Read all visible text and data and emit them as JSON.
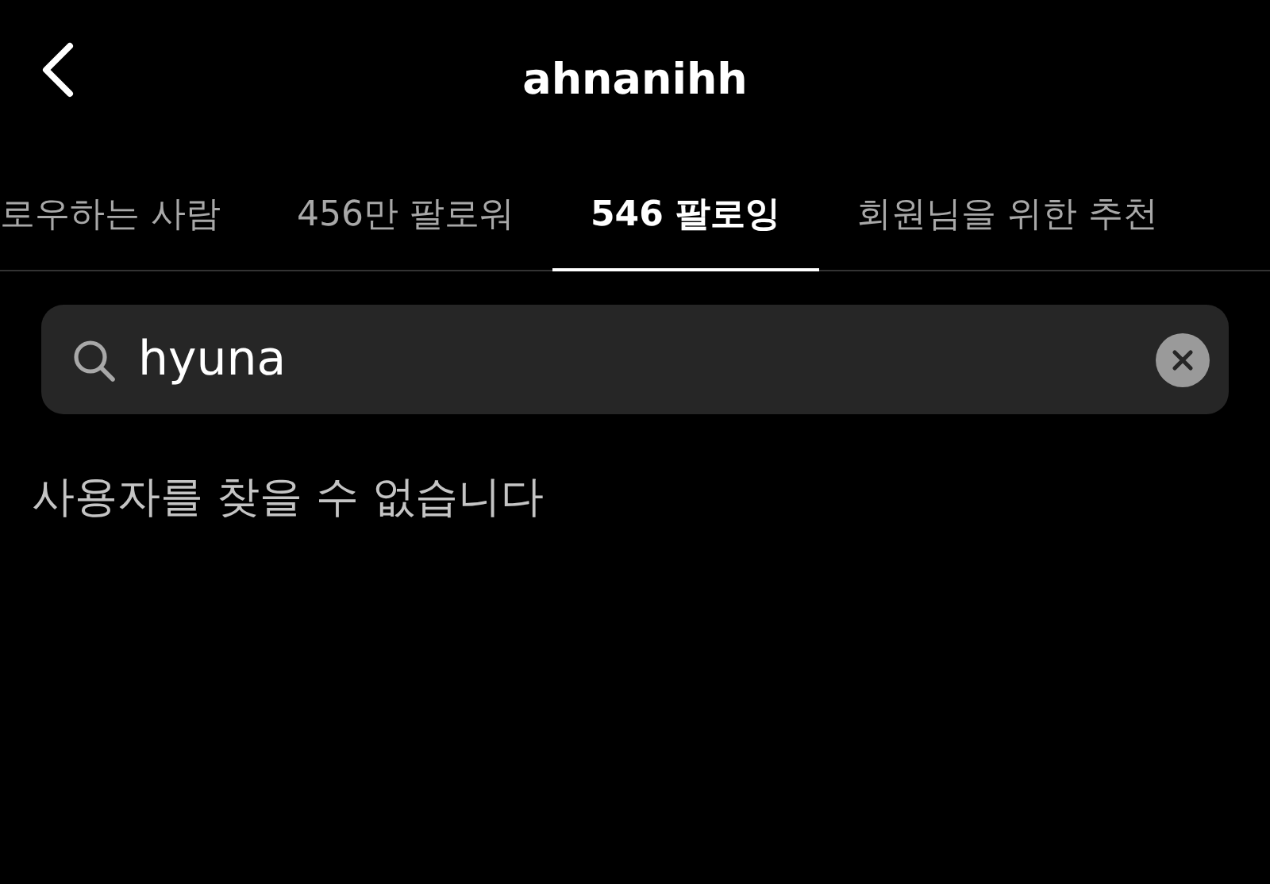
{
  "header": {
    "title": "ahnanihh"
  },
  "tabs": [
    {
      "label": "로우하는 사람",
      "selected": false
    },
    {
      "label": "456만 팔로워",
      "selected": false
    },
    {
      "label": "546 팔로잉",
      "selected": true
    },
    {
      "label": "회원님을 위한 추천",
      "selected": false
    }
  ],
  "search": {
    "value": "hyuna"
  },
  "message": "사용자를 찾을 수 없습니다"
}
